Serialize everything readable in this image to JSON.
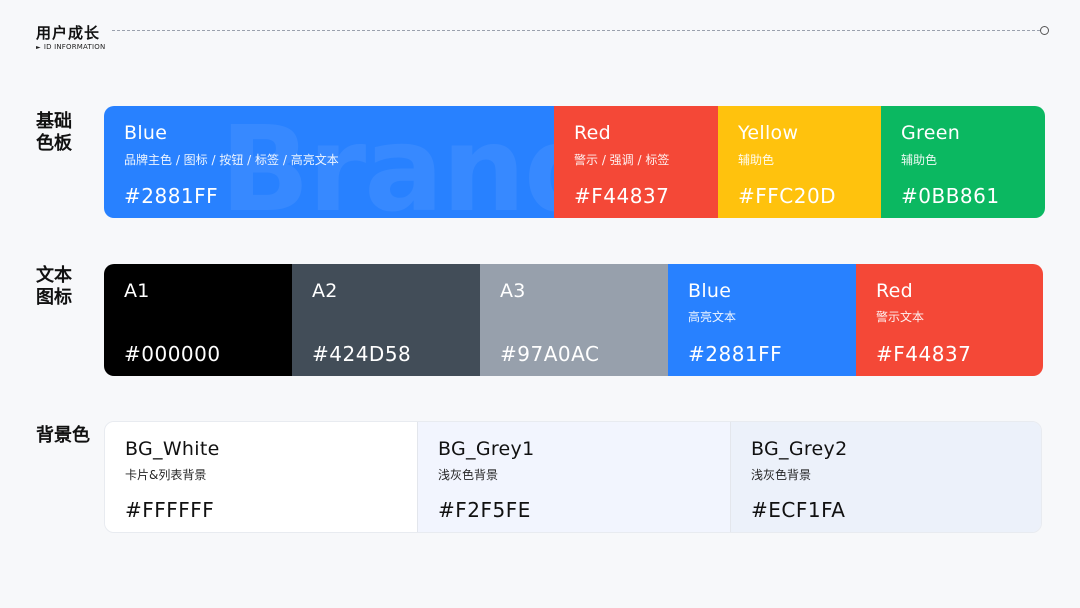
{
  "header": {
    "title": "用户成长",
    "subtitle": "ID INFORMATION",
    "subtitle_marker": "►"
  },
  "sections": {
    "brand": {
      "label_line1": "基础",
      "label_line2": "色板",
      "watermark": "Brand",
      "swatches": [
        {
          "name": "Blue",
          "desc": "品牌主色 / 图标 / 按钮 / 标签 / 高亮文本",
          "hex": "#2881FF",
          "color": "#2881FF"
        },
        {
          "name": "Red",
          "desc": "警示 / 强调 / 标签",
          "hex": "#F44837",
          "color": "#F44837"
        },
        {
          "name": "Yellow",
          "desc": "辅助色",
          "hex": "#FFC20D",
          "color": "#FFC20D"
        },
        {
          "name": "Green",
          "desc": "辅助色",
          "hex": "#0BB861",
          "color": "#0BB861"
        }
      ]
    },
    "text_icon": {
      "label_line1": "文本",
      "label_line2": "图标",
      "swatches": [
        {
          "name": "A1",
          "desc": "",
          "hex": "#000000",
          "color": "#000000"
        },
        {
          "name": "A2",
          "desc": "",
          "hex": "#424D58",
          "color": "#424D58"
        },
        {
          "name": "A3",
          "desc": "",
          "hex": "#97A0AC",
          "color": "#97A0AC"
        },
        {
          "name": "Blue",
          "desc": "高亮文本",
          "hex": "#2881FF",
          "color": "#2881FF"
        },
        {
          "name": "Red",
          "desc": "警示文本",
          "hex": "#F44837",
          "color": "#F44837"
        }
      ]
    },
    "background": {
      "label_line1": "背景色",
      "swatches": [
        {
          "name": "BG_White",
          "desc": "卡片&列表背景",
          "hex": "#FFFFFF",
          "color": "#FFFFFF"
        },
        {
          "name": "BG_Grey1",
          "desc": "浅灰色背景",
          "hex": "#F2F5FE",
          "color": "#F2F5FE"
        },
        {
          "name": "BG_Grey2",
          "desc": "浅灰色背景",
          "hex": "#ECF1FA",
          "color": "#ECF1FA"
        }
      ]
    }
  }
}
